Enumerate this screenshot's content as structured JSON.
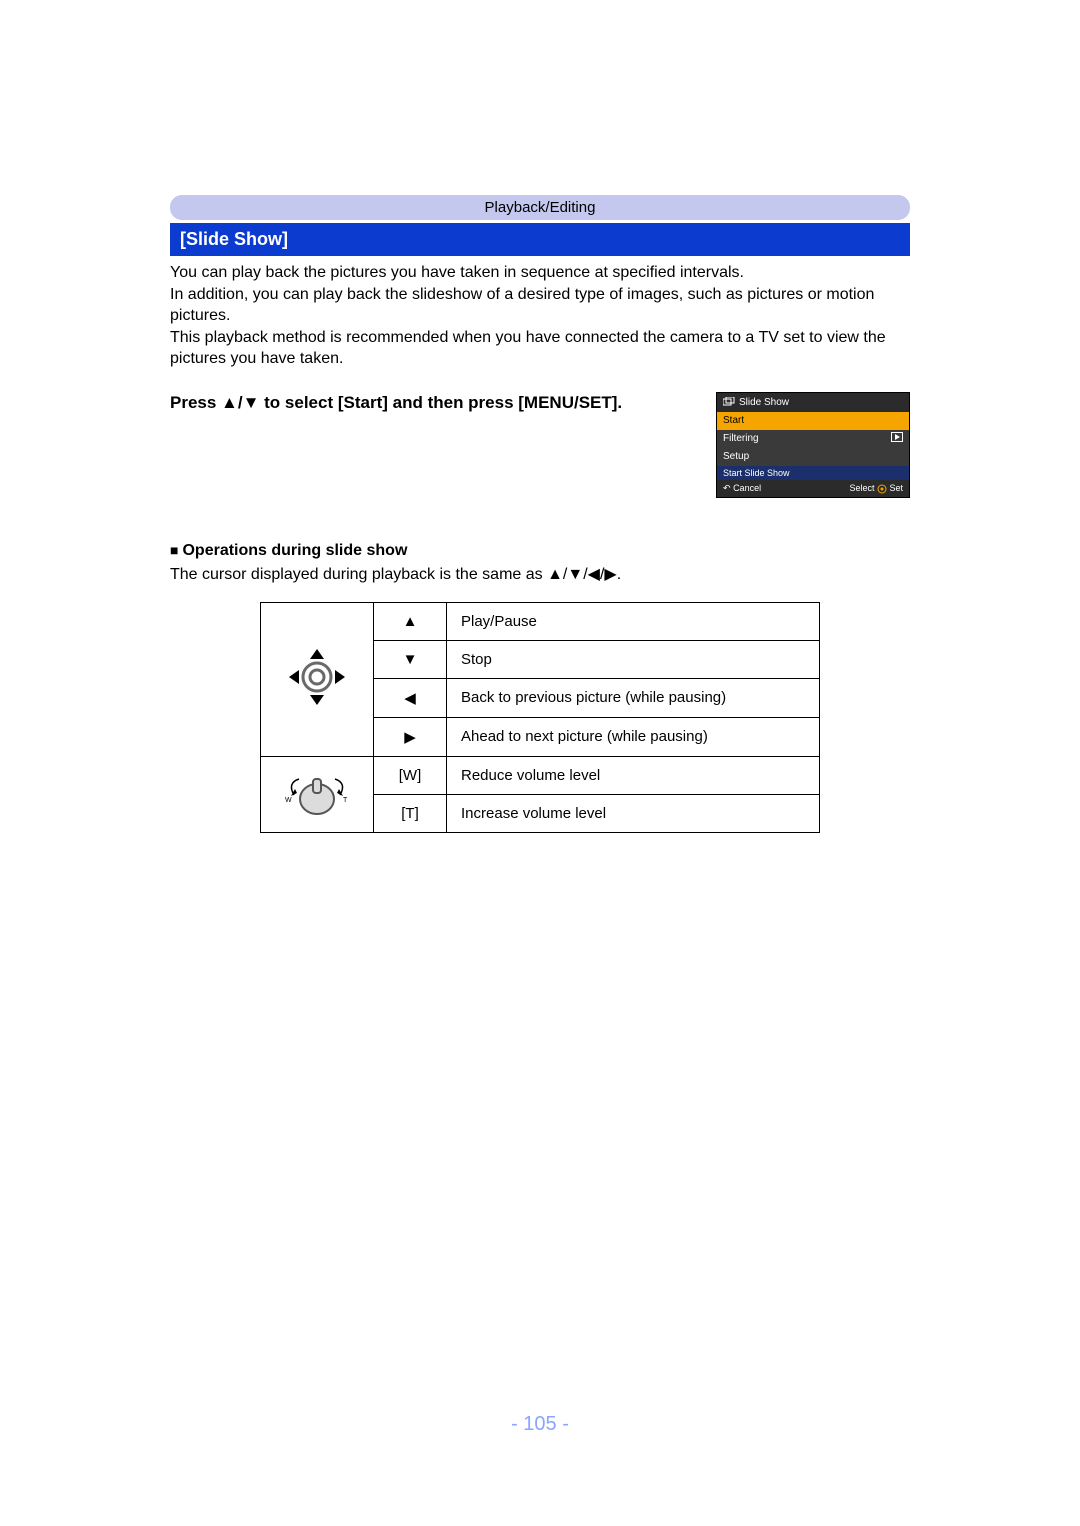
{
  "breadcrumb": "Playback/Editing",
  "section_title": "[Slide Show]",
  "paragraphs": {
    "p1": "You can play back the pictures you have taken in sequence at specified intervals.",
    "p2": "In addition, you can play back the slideshow of a desired type of images, such as pictures or motion pictures.",
    "p3": "This playback method is recommended when you have connected the camera to a TV set to view the pictures you have taken."
  },
  "instruction": {
    "prefix": "Press ",
    "arrows": "▲/▼",
    "suffix": " to select [Start] and then press [MENU/SET]."
  },
  "menu": {
    "title": "Slide Show",
    "items": {
      "start": "Start",
      "filtering": "Filtering",
      "setup": "Setup"
    },
    "strip": "Start Slide Show",
    "footer_left_icon": "↶",
    "footer_left": "Cancel",
    "footer_right_a": "Select",
    "footer_right_b": "Set"
  },
  "sub_heading": "Operations during slide show",
  "cursor_line": {
    "prefix": "The cursor displayed during playback is the same as ",
    "arrows": "▲/▼/◀/▶",
    "suffix": "."
  },
  "controls": {
    "up": {
      "sym": "▲",
      "label": "Play/Pause"
    },
    "down": {
      "sym": "▼",
      "label": "Stop"
    },
    "left": {
      "sym": "◀",
      "label": "Back to previous picture (while pausing)"
    },
    "right": {
      "sym": "▶",
      "label": "Ahead to next picture (while pausing)"
    },
    "w": {
      "sym": "[W]",
      "label": "Reduce volume level"
    },
    "t": {
      "sym": "[T]",
      "label": "Increase volume level"
    }
  },
  "page_number": "- 105 -"
}
